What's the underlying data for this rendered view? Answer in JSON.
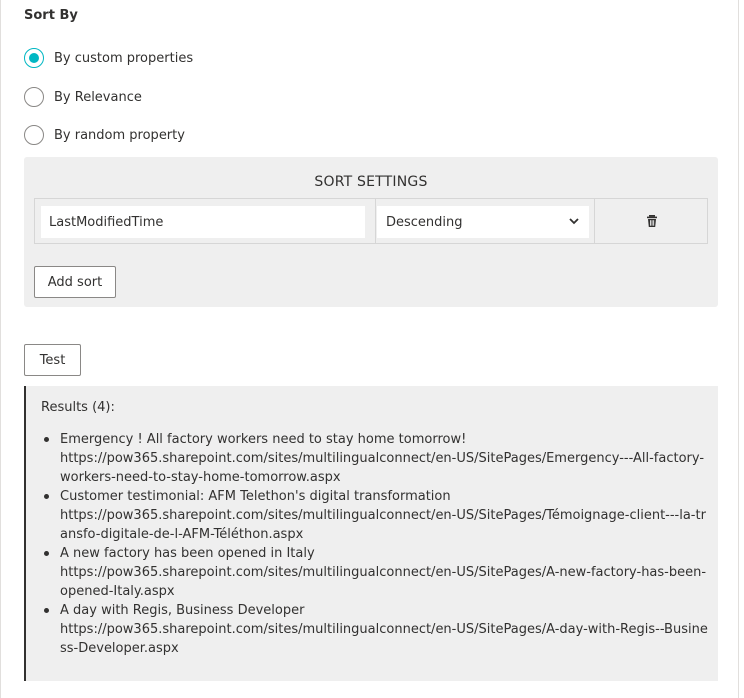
{
  "sort_by": {
    "title": "Sort By",
    "options": [
      {
        "label": "By custom properties",
        "checked": true
      },
      {
        "label": "By Relevance",
        "checked": false
      },
      {
        "label": "By random property",
        "checked": false
      }
    ]
  },
  "sort_settings": {
    "title": "SORT SETTINGS",
    "rows": [
      {
        "field": "LastModifiedTime",
        "order": "Descending"
      }
    ],
    "add_sort_label": "Add sort",
    "trash_icon": "trash-icon"
  },
  "test_label": "Test",
  "results": {
    "header": "Results (4):",
    "items": [
      {
        "title": "Emergency ! All factory workers need to stay home tomorrow!",
        "url": "https://pow365.sharepoint.com/sites/multilingualconnect/en-US/SitePages/Emergency---All-factory-workers-need-to-stay-home-tomorrow.aspx"
      },
      {
        "title": "Customer testimonial: AFM Telethon's digital transformation",
        "url": "https://pow365.sharepoint.com/sites/multilingualconnect/en-US/SitePages/Témoignage-client---la-transfo-digitale-de-l-AFM-Téléthon.aspx"
      },
      {
        "title": "A new factory has been opened in Italy",
        "url": "https://pow365.sharepoint.com/sites/multilingualconnect/en-US/SitePages/A-new-factory-has-been-opened-Italy.aspx"
      },
      {
        "title": "A day with Regis, Business Developer",
        "url": "https://pow365.sharepoint.com/sites/multilingualconnect/en-US/SitePages/A-day-with-Regis--Business-Developer.aspx"
      }
    ]
  },
  "colors": {
    "accent": "#00b7c3",
    "panel_bg": "#efefef",
    "text": "#323130"
  }
}
